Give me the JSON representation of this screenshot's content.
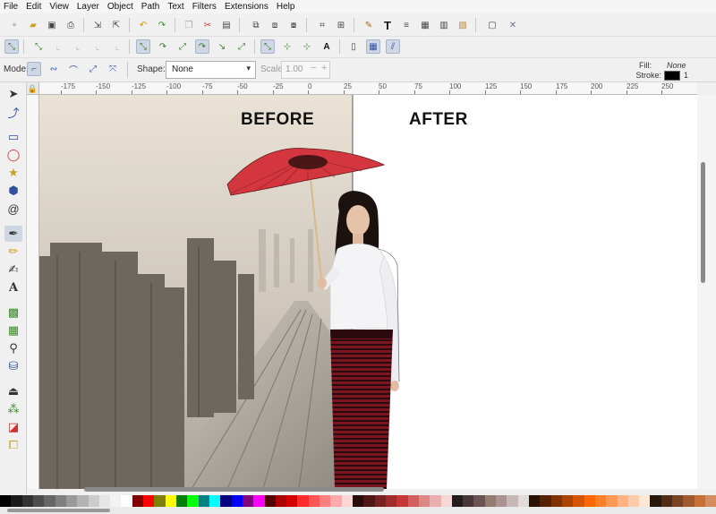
{
  "menubar": {
    "items": [
      "File",
      "Edit",
      "View",
      "Layer",
      "Object",
      "Path",
      "Text",
      "Filters",
      "Extensions",
      "Help"
    ]
  },
  "tool_controls": {
    "mode_label": "Mode:",
    "shape_label": "Shape:",
    "shape_value": "None",
    "scale_label": "Scale:",
    "scale_value": "1.00",
    "fill_label": "Fill:",
    "fill_value": "None",
    "stroke_label": "Stroke:",
    "stroke_width": "1",
    "stroke_color": "#000000"
  },
  "ruler": {
    "corner_icon": "lock-icon",
    "ticks": [
      "-175",
      "-150",
      "-125",
      "-100",
      "-75",
      "-50",
      "-25",
      "0",
      "25",
      "50",
      "75",
      "100",
      "125",
      "150",
      "175",
      "200",
      "225",
      "250"
    ]
  },
  "canvas": {
    "label_before": "BEFORE",
    "label_after": "AFTER"
  },
  "palette": {
    "colors": [
      "#000000",
      "#1a1a1a",
      "#333333",
      "#4d4d4d",
      "#666666",
      "#808080",
      "#999999",
      "#b3b3b3",
      "#cccccc",
      "#e6e6e6",
      "#f2f2f2",
      "#ffffff",
      "#800000",
      "#ff0000",
      "#808000",
      "#ffff00",
      "#008000",
      "#00ff00",
      "#008080",
      "#00ffff",
      "#000080",
      "#0000ff",
      "#800080",
      "#ff00ff",
      "#550000",
      "#aa0000",
      "#d40000",
      "#ff2a2a",
      "#ff5555",
      "#ff8080",
      "#ffaaaa",
      "#ffd5d5",
      "#280b0b",
      "#501616",
      "#782121",
      "#a02c2c",
      "#c83737",
      "#d35f5f",
      "#de8787",
      "#e9afaf",
      "#f4d7d7",
      "#241c1c",
      "#483737",
      "#6c5353",
      "#917c6f",
      "#ac9393",
      "#c8b7b7",
      "#e3dbdb",
      "#2b1100",
      "#552200",
      "#803300",
      "#aa4400",
      "#d45500",
      "#ff6600",
      "#ff7f2a",
      "#ff9955",
      "#ffb380",
      "#ffccaa",
      "#ffe6d5",
      "#28170b",
      "#502d16",
      "#784421",
      "#a05a2c",
      "#c87137",
      "#d38d5f"
    ]
  }
}
